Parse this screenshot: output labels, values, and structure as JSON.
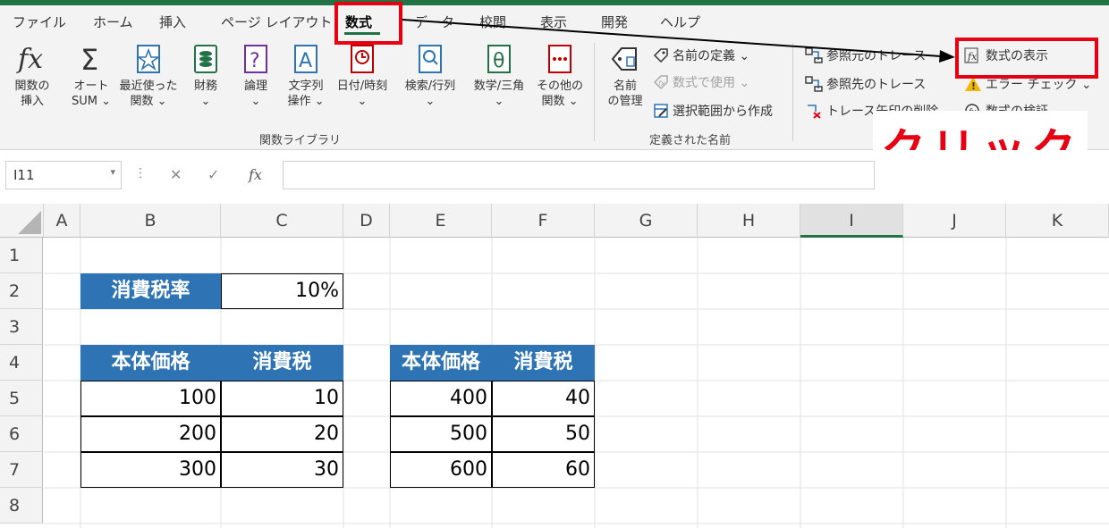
{
  "tabs": [
    "ファイル",
    "ホーム",
    "挿入",
    "ページ レイアウト",
    "数式",
    "データ",
    "校閲",
    "表示",
    "開発",
    "ヘルプ"
  ],
  "function_library": {
    "group_label": "関数ライブラリ",
    "commands": [
      {
        "line1": "関数の",
        "line2": "挿入"
      },
      {
        "line1": "オート",
        "line2": "SUM ⌄"
      },
      {
        "line1": "最近使った",
        "line2": "関数 ⌄"
      },
      {
        "line1": "財務",
        "line2": "⌄"
      },
      {
        "line1": "論理",
        "line2": "⌄"
      },
      {
        "line1": "文字列",
        "line2": "操作 ⌄"
      },
      {
        "line1": "日付/時刻",
        "line2": "⌄"
      },
      {
        "line1": "検索/行列",
        "line2": "⌄"
      },
      {
        "line1": "数学/三角",
        "line2": "⌄"
      },
      {
        "line1": "その他の",
        "line2": "関数 ⌄"
      }
    ]
  },
  "defined_names": {
    "group_label": "定義された名前",
    "name_manager": {
      "line1": "名前",
      "line2": "の管理"
    },
    "define_name": "名前の定義 ⌄",
    "use_in_formula": "数式で使用 ⌄",
    "create_from_selection": "選択範囲から作成"
  },
  "formula_auditing": {
    "trace_precedents": "参照元のトレース",
    "trace_dependents": "参照先のトレース",
    "remove_arrows": "トレース矢印の削除 ⌄",
    "show_formulas": "数式の表示",
    "error_checking": "エラー チェック ⌄",
    "evaluate_formula": "数式の検証"
  },
  "annotation": {
    "click_text": "クリック",
    "color": "#e60012"
  },
  "formula_bar": {
    "name_box": "I11",
    "cancel": "✕",
    "enter": "✓",
    "fx": "fx"
  },
  "grid": {
    "columns": [
      "A",
      "B",
      "C",
      "D",
      "E",
      "F",
      "G",
      "H",
      "I",
      "J",
      "K"
    ],
    "rows": [
      "1",
      "2",
      "3",
      "4",
      "5",
      "6",
      "7",
      "8"
    ],
    "selected_column": "I",
    "tax_rate_label": "消費税率",
    "tax_rate_value": "10%",
    "table1": {
      "headers": [
        "本体価格",
        "消費税"
      ],
      "rows": [
        [
          "100",
          "10"
        ],
        [
          "200",
          "20"
        ],
        [
          "300",
          "30"
        ]
      ]
    },
    "table2": {
      "headers": [
        "本体価格",
        "消費税"
      ],
      "rows": [
        [
          "400",
          "40"
        ],
        [
          "500",
          "50"
        ],
        [
          "600",
          "60"
        ]
      ]
    }
  },
  "colors": {
    "excel_green": "#217346",
    "header_blue": "#2e74b5",
    "highlight_red": "#e60012"
  }
}
